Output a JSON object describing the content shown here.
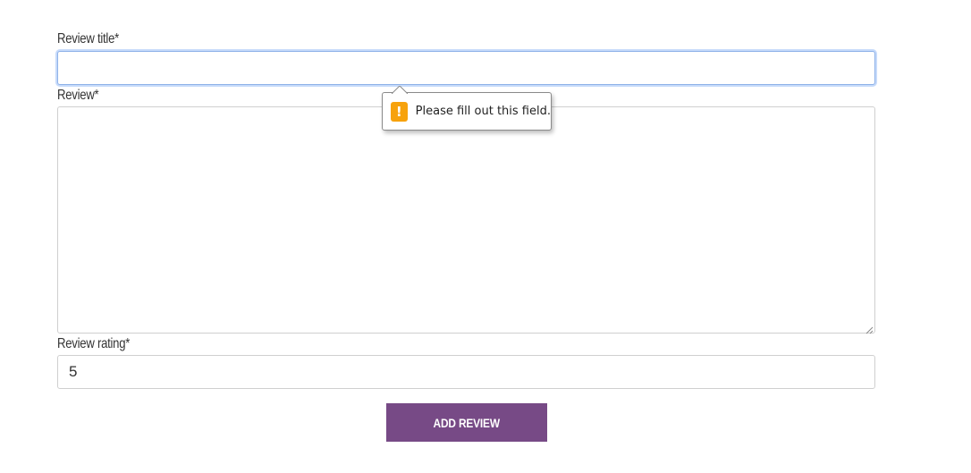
{
  "form": {
    "title_label": "Review title*",
    "title_value": "",
    "review_label": "Review*",
    "review_value": "",
    "rating_label": "Review rating*",
    "rating_value": "5",
    "submit_label": "ADD REVIEW"
  },
  "validation": {
    "message": "Please fill out this field.",
    "icon": "warning-icon",
    "icon_glyph": "!",
    "icon_color": "#f7a20c"
  },
  "colors": {
    "accent": "#774a86",
    "focus_ring": "#c6dafa"
  }
}
